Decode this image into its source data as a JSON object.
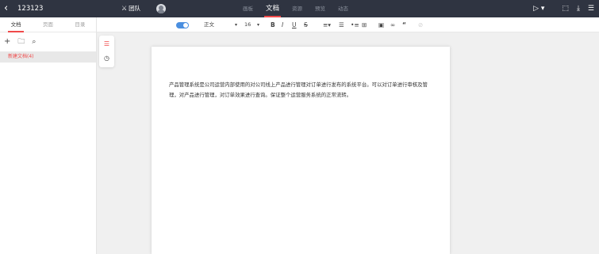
{
  "header": {
    "back_icon": "chevron-left-icon",
    "title": "123123",
    "team_label": "团队",
    "nav_tabs": [
      {
        "label": "画板",
        "active": false
      },
      {
        "label": "文档",
        "active": true
      },
      {
        "label": "资源",
        "active": false
      },
      {
        "label": "预览",
        "active": false
      },
      {
        "label": "动态",
        "active": false
      }
    ],
    "accent_color": "#f04a4a"
  },
  "left_panel": {
    "tabs": [
      {
        "label": "文档",
        "active": true
      },
      {
        "label": "页面",
        "active": false
      },
      {
        "label": "目录",
        "active": false
      }
    ],
    "document_item": "新建文档(4)"
  },
  "toolbar": {
    "paragraph_style": "正文",
    "font_size": "16"
  },
  "document": {
    "text": "产品管理系统是公司运营内部使用的对公司线上产品进行管理对订单进行发布的系统平台。可以对订单进行审核及管理，对产品进行管理，对订单效果进行查询。保证整个运营服务系统的正常流转。"
  }
}
